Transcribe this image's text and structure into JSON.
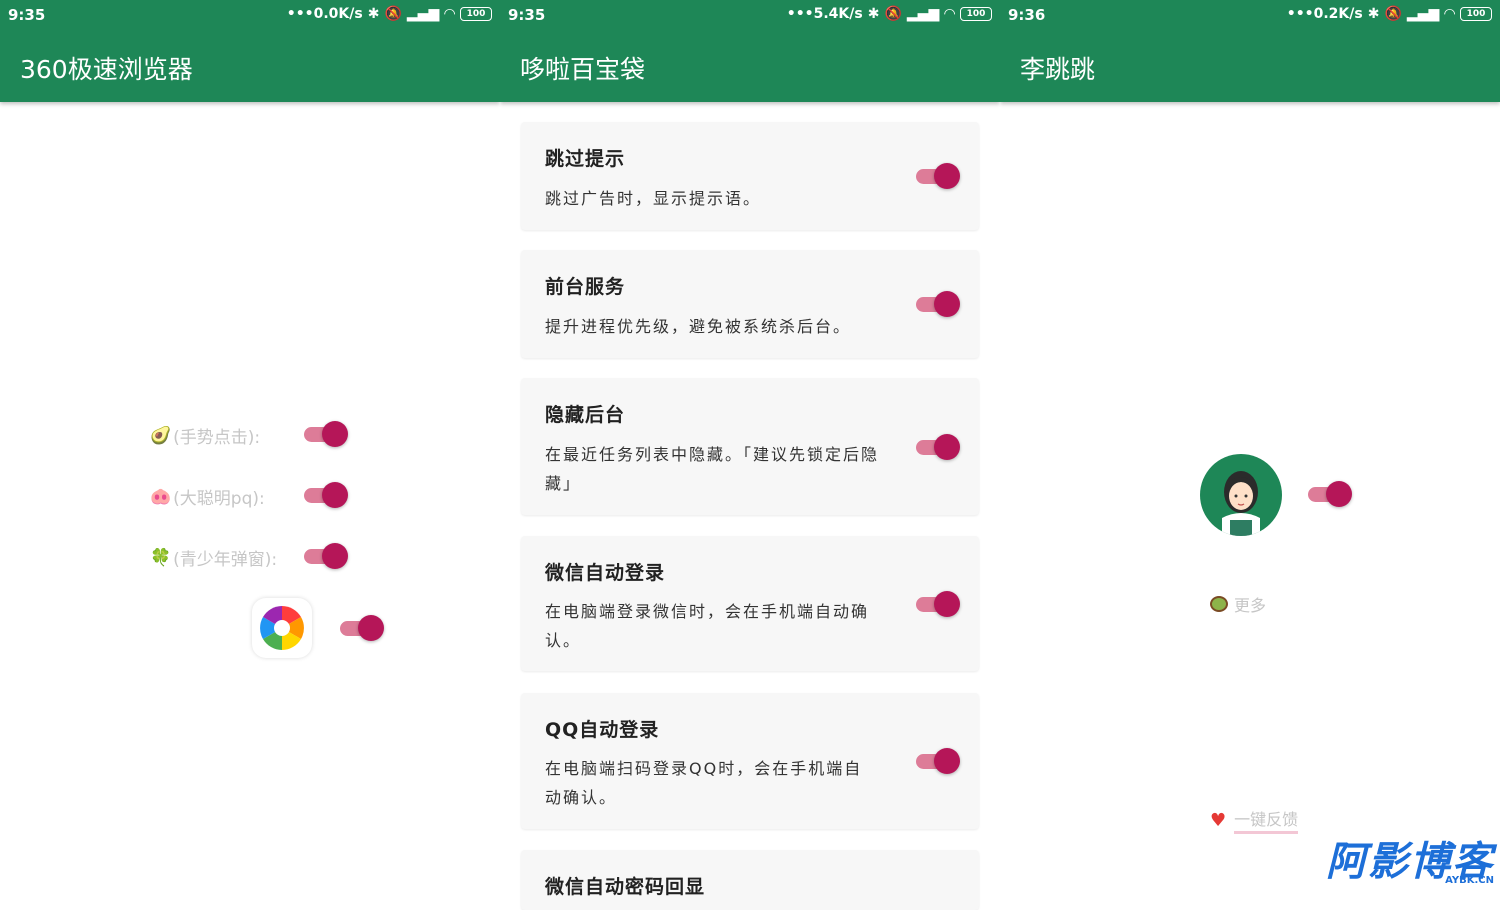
{
  "panels": [
    {
      "time": "9:35",
      "speed": "•••0.0K/s",
      "battery": "100",
      "title": "360极速浏览器",
      "gesture_rows": [
        {
          "emoji": "🥑",
          "label": "(手势点击):"
        },
        {
          "emoji": "🐽",
          "label": "(大聪明pq):"
        },
        {
          "emoji": "🍀",
          "label": "(青少年弹窗):"
        }
      ]
    },
    {
      "time": "9:35",
      "speed": "•••5.4K/s",
      "battery": "100",
      "title": "哆啦百宝袋",
      "cards": [
        {
          "title": "跳过提示",
          "desc": "跳过广告时，显示提示语。"
        },
        {
          "title": "前台服务",
          "desc": "提升进程优先级，避免被系统杀后台。"
        },
        {
          "title": "隐藏后台",
          "desc": "在最近任务列表中隐藏。「建议先锁定后隐藏」"
        },
        {
          "title": "微信自动登录",
          "desc": "在电脑端登录微信时，会在手机端自动确认。"
        },
        {
          "title": "QQ自动登录",
          "desc": "在电脑端扫码登录QQ时，会在手机端自动确认。"
        },
        {
          "title": "微信自动密码回显",
          "desc": ""
        }
      ]
    },
    {
      "time": "9:36",
      "speed": "•••0.2K/s",
      "battery": "100",
      "title": "李跳跳",
      "more_label": "更多",
      "feedback_label": "一键反馈"
    }
  ],
  "watermark": {
    "main": "阿影博客",
    "sub": "AYBK.CN"
  },
  "colors": {
    "appbar": "#1e8757",
    "toggle_thumb": "#b51658",
    "toggle_track": "#dd7c98"
  }
}
